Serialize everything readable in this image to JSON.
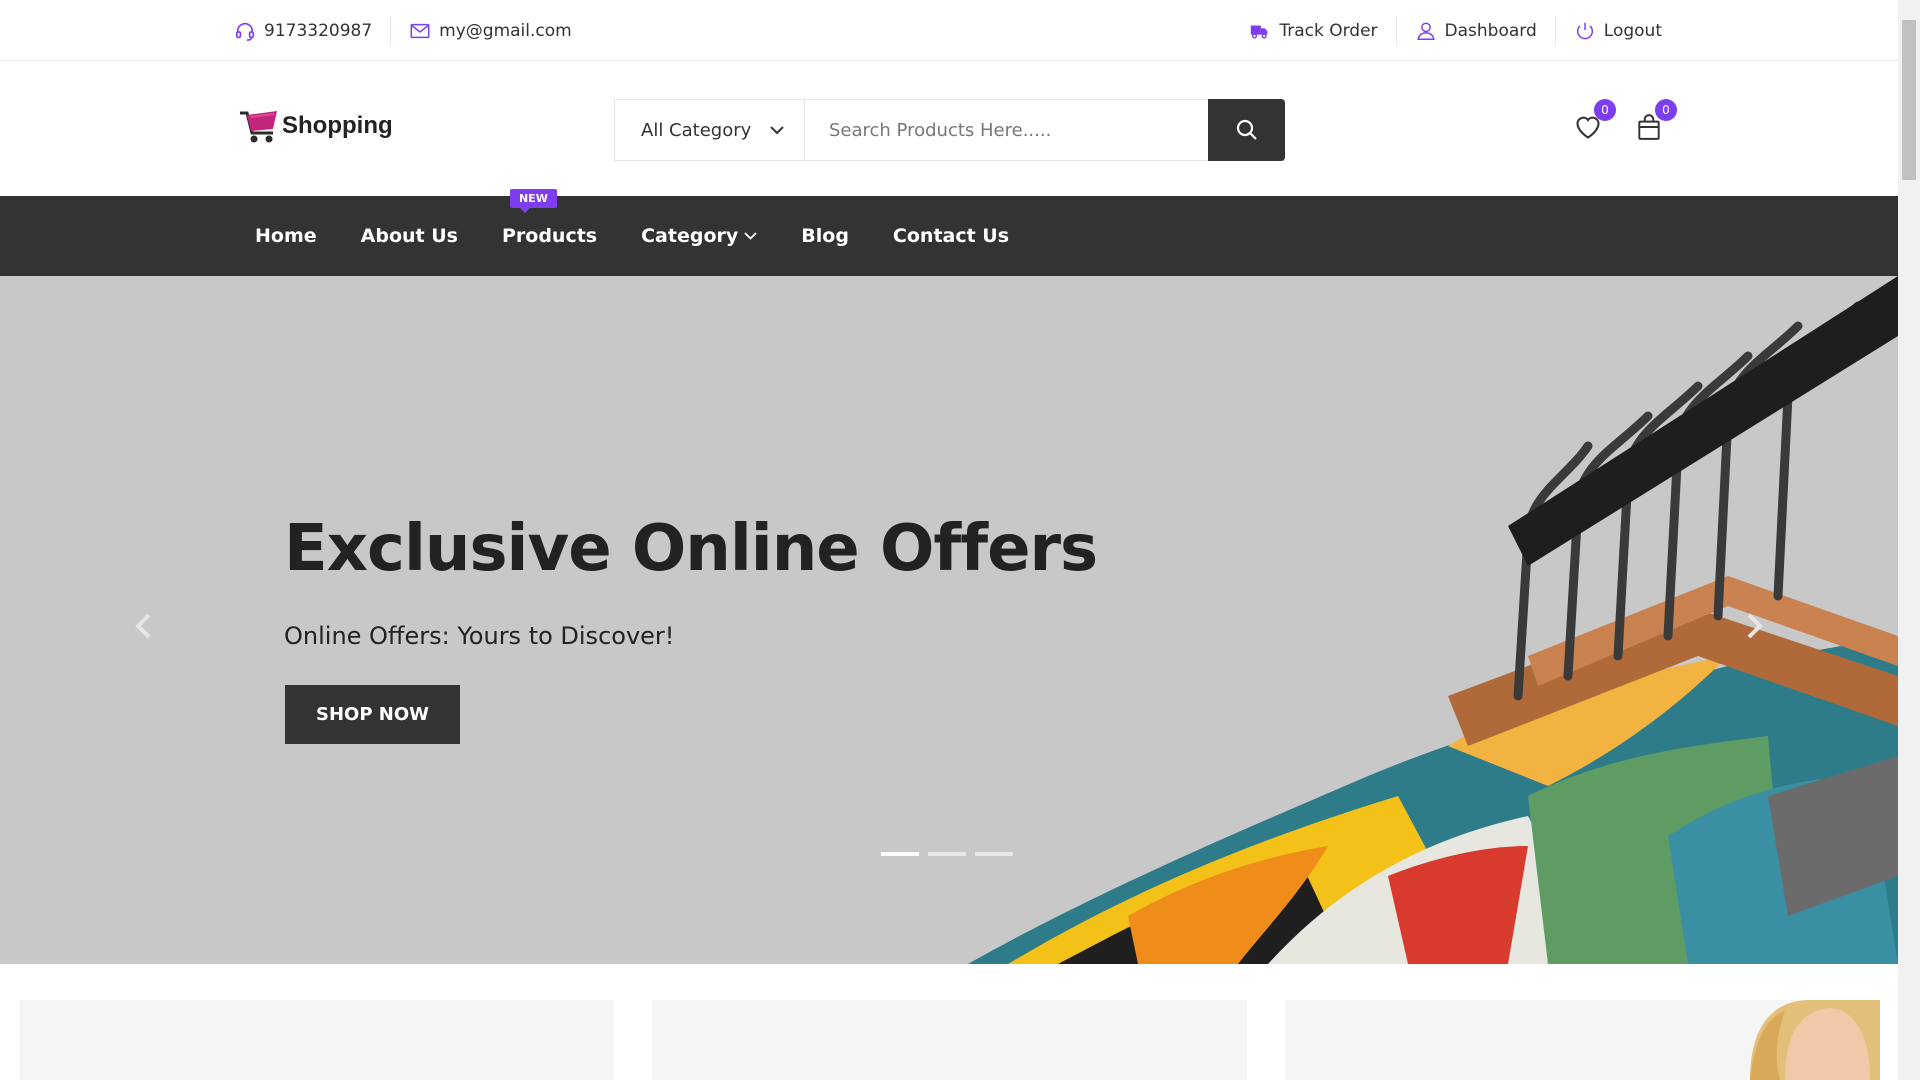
{
  "topbar": {
    "phone": "9173320987",
    "email": "my@gmail.com",
    "track_order": "Track Order",
    "dashboard": "Dashboard",
    "logout": "Logout"
  },
  "header": {
    "logo_text": "Shopping",
    "category_select": "All Category",
    "search_placeholder": "Search Products Here.....",
    "wishlist_count": "0",
    "cart_count": "0"
  },
  "nav": {
    "items": [
      {
        "label": "Home"
      },
      {
        "label": "About Us"
      },
      {
        "label": "Products",
        "tag": "NEW"
      },
      {
        "label": "Category"
      },
      {
        "label": "Blog"
      },
      {
        "label": "Contact Us"
      }
    ]
  },
  "hero": {
    "title": "Exclusive Online Offers",
    "subtitle": "Online Offers: Yours to Discover!",
    "button": "SHOP NOW",
    "slide_count": 3,
    "active_slide": 1
  },
  "colors": {
    "accent": "#7e3df0",
    "dark": "#333333",
    "hero_bg": "#c8c8c8"
  }
}
